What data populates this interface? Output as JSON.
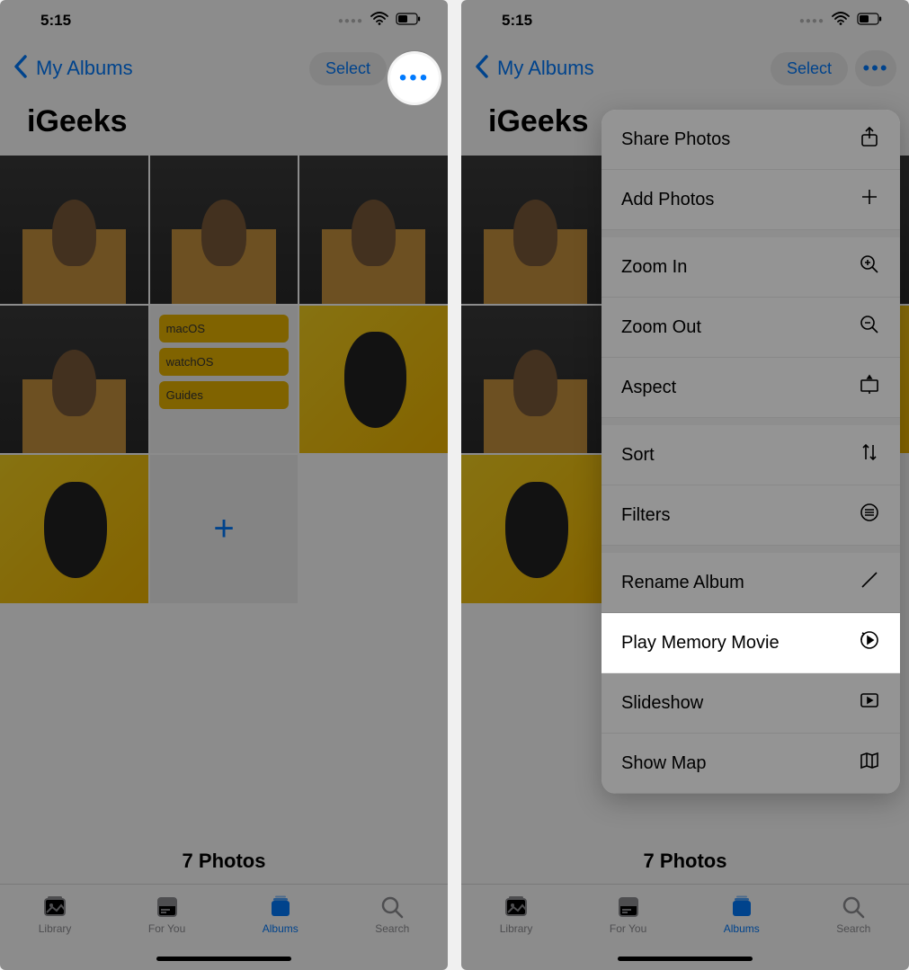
{
  "status": {
    "time": "5:15"
  },
  "nav": {
    "back_label": "My Albums",
    "select_label": "Select"
  },
  "album": {
    "title": "iGeeks",
    "count_label": "7 Photos",
    "chips": [
      "macOS",
      "watchOS",
      "Guides"
    ]
  },
  "tabs": {
    "library": "Library",
    "foryou": "For You",
    "albums": "Albums",
    "search": "Search"
  },
  "menu": {
    "share": "Share Photos",
    "add": "Add Photos",
    "zoom_in": "Zoom In",
    "zoom_out": "Zoom Out",
    "aspect": "Aspect",
    "sort": "Sort",
    "filters": "Filters",
    "rename": "Rename Album",
    "play_memory": "Play Memory Movie",
    "slideshow": "Slideshow",
    "show_map": "Show Map"
  }
}
